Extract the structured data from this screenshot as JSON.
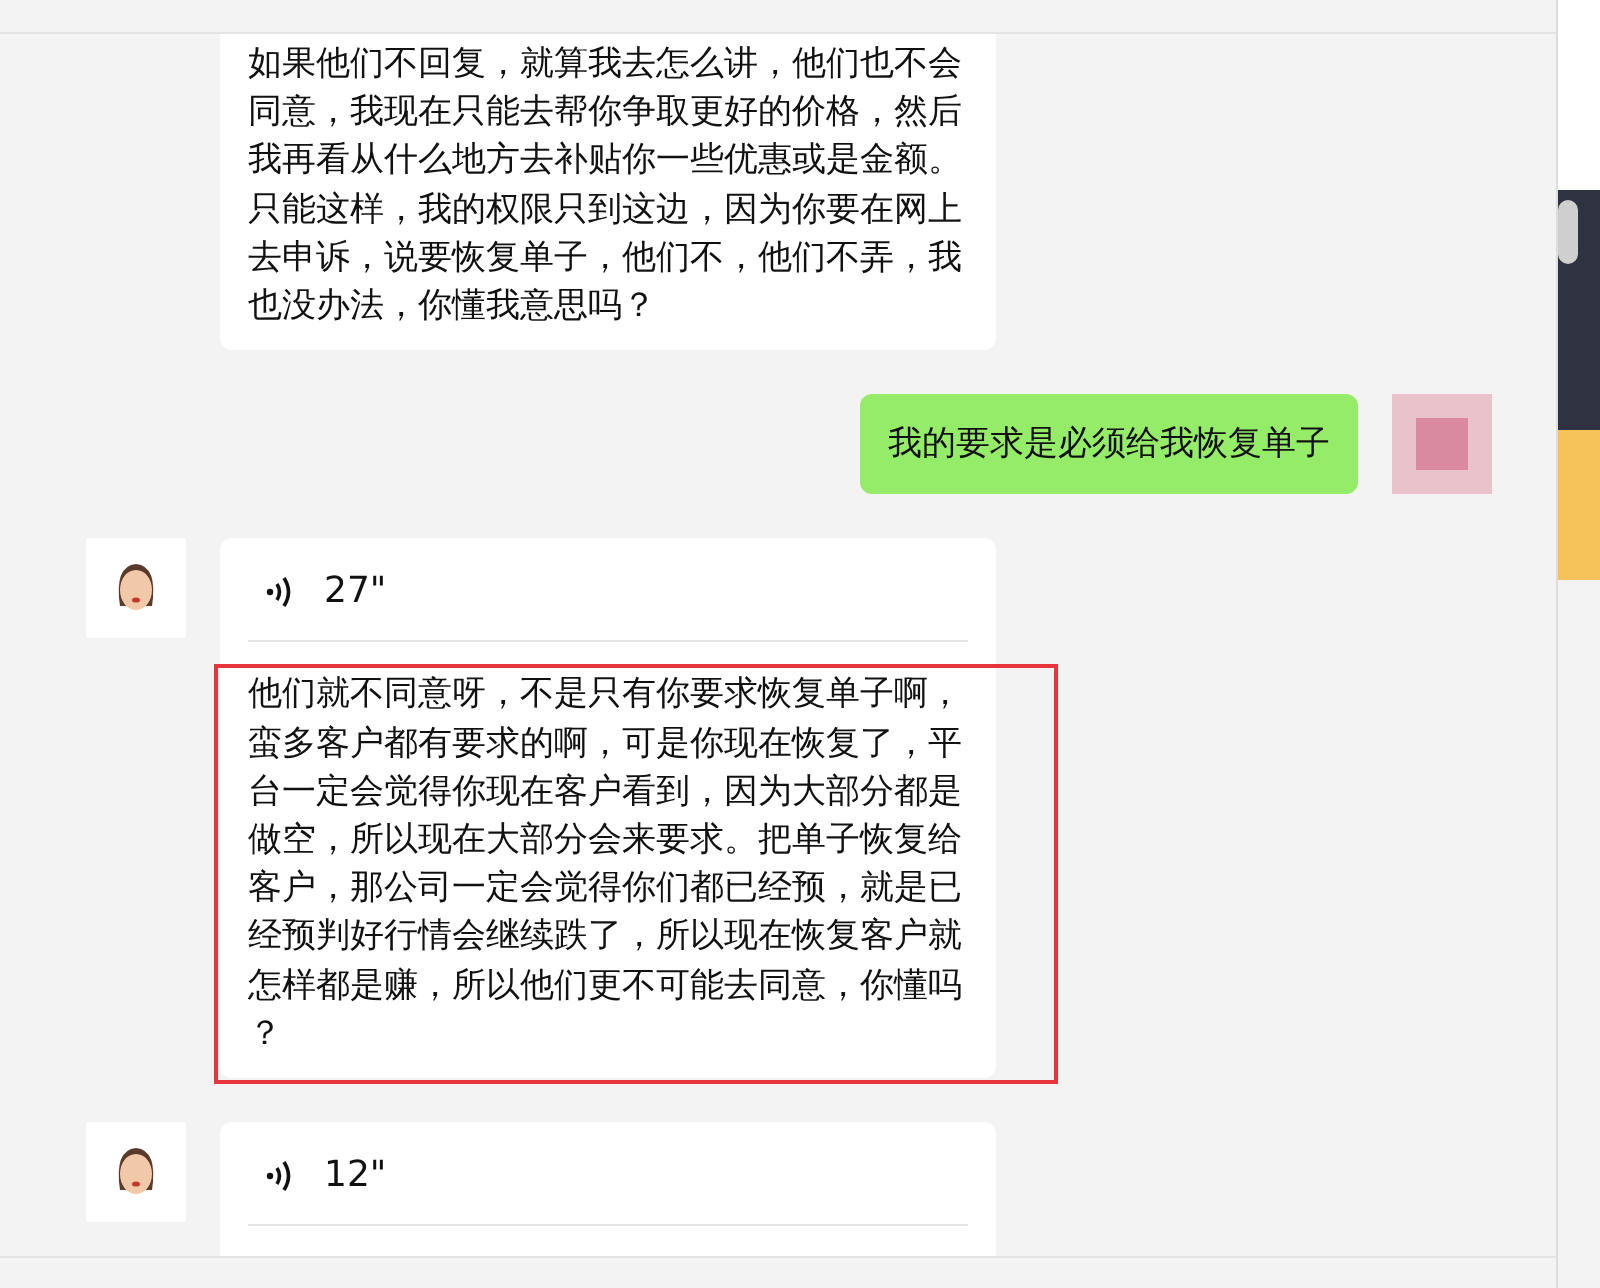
{
  "messages": [
    {
      "kind": "incoming_text",
      "text": "如果他们不回复，就算我去怎么讲，他们也不会同意，我现在只能去帮你争取更好的价格，然后我再看从什么地方去补贴你一些优惠或是金额。只能这样，我的权限只到这边，因为你要在网上去申诉，说要恢复单子，他们不，他们不弄，我也没办法，你懂我意思吗？",
      "highlighted": false
    },
    {
      "kind": "outgoing_text",
      "text": "我的要求是必须给我恢复单子",
      "highlighted": false
    },
    {
      "kind": "incoming_voice",
      "duration": "27\"",
      "text": "他们就不同意呀，不是只有你要求恢复单子啊，蛮多客户都有要求的啊，可是你现在恢复了，平台一定会觉得你现在客户看到，因为大部分都是做空，所以现在大部分会来要求。把单子恢复给客户，那公司一定会觉得你们都已经预，就是已经预判好行情会继续跌了，所以现在恢复客户就怎样都是赚，所以他们更不可能去同意，你懂吗？",
      "highlighted": true
    },
    {
      "kind": "incoming_voice",
      "duration": "12\"",
      "highlighted": false
    }
  ]
}
